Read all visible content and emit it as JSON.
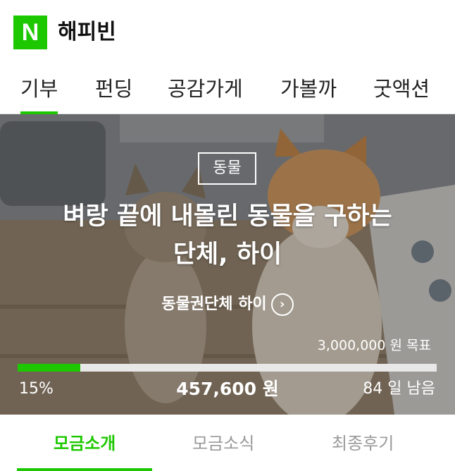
{
  "header": {
    "logo_letter": "N",
    "service_name": "해피빈",
    "brand_color": "#1ec800"
  },
  "gnb": {
    "items": [
      {
        "label": "기부",
        "active": true
      },
      {
        "label": "펀딩"
      },
      {
        "label": "공감가게"
      },
      {
        "label": "가볼까"
      },
      {
        "label": "굿액션"
      }
    ]
  },
  "campaign": {
    "category": "동물",
    "title_line1": "벼랑 끝에 내몰린 동물을 구하는",
    "title_line2": "단체, 하이",
    "organization": "동물권단체 하이",
    "chevron": "chevron-right-icon",
    "goal_amount": "3,000,000",
    "goal_suffix": "원 목표",
    "progress_percent": 15,
    "progress_label": "15%",
    "raised_amount": "457,600",
    "raised_unit": "원",
    "days_left": "84",
    "days_suffix": "일 남음"
  },
  "tabs": {
    "items": [
      {
        "label": "모금소개",
        "active": true
      },
      {
        "label": "모금소식"
      },
      {
        "label": "최종후기"
      }
    ]
  }
}
